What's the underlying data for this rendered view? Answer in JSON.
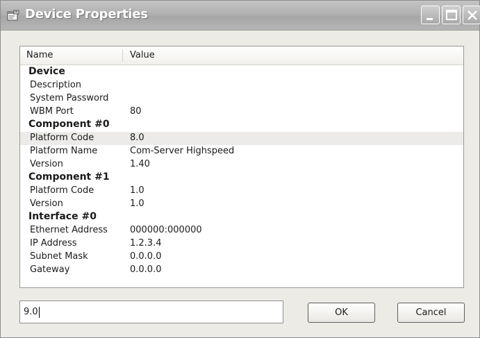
{
  "window": {
    "title": "Device Properties"
  },
  "list": {
    "columns": [
      "Name",
      "Value"
    ],
    "rows": [
      {
        "type": "group",
        "name": "Device",
        "value": ""
      },
      {
        "type": "item",
        "name": "Description",
        "value": ""
      },
      {
        "type": "item",
        "name": "System Password",
        "value": ""
      },
      {
        "type": "item",
        "name": "WBM Port",
        "value": "80"
      },
      {
        "type": "group",
        "name": "Component #0",
        "value": ""
      },
      {
        "type": "item",
        "name": "Platform Code",
        "value": "8.0",
        "selected": true
      },
      {
        "type": "item",
        "name": "Platform Name",
        "value": "Com-Server Highspeed"
      },
      {
        "type": "item",
        "name": "Version",
        "value": "1.40"
      },
      {
        "type": "group",
        "name": "Component #1",
        "value": ""
      },
      {
        "type": "item",
        "name": "Platform Code",
        "value": "1.0"
      },
      {
        "type": "item",
        "name": "Version",
        "value": "1.0"
      },
      {
        "type": "group",
        "name": "Interface #0",
        "value": ""
      },
      {
        "type": "item",
        "name": "Ethernet Address",
        "value": "000000:000000"
      },
      {
        "type": "item",
        "name": "IP Address",
        "value": "1.2.3.4"
      },
      {
        "type": "item",
        "name": "Subnet Mask",
        "value": "0.0.0.0"
      },
      {
        "type": "item",
        "name": "Gateway",
        "value": "0.0.0.0"
      }
    ]
  },
  "editor": {
    "value": "9.0"
  },
  "buttons": {
    "ok_label": "OK",
    "cancel_label": "Cancel"
  },
  "icons": {
    "title": "properties-icon",
    "minimize": "minimize-icon",
    "maximize": "maximize-icon",
    "close": "close-icon"
  }
}
